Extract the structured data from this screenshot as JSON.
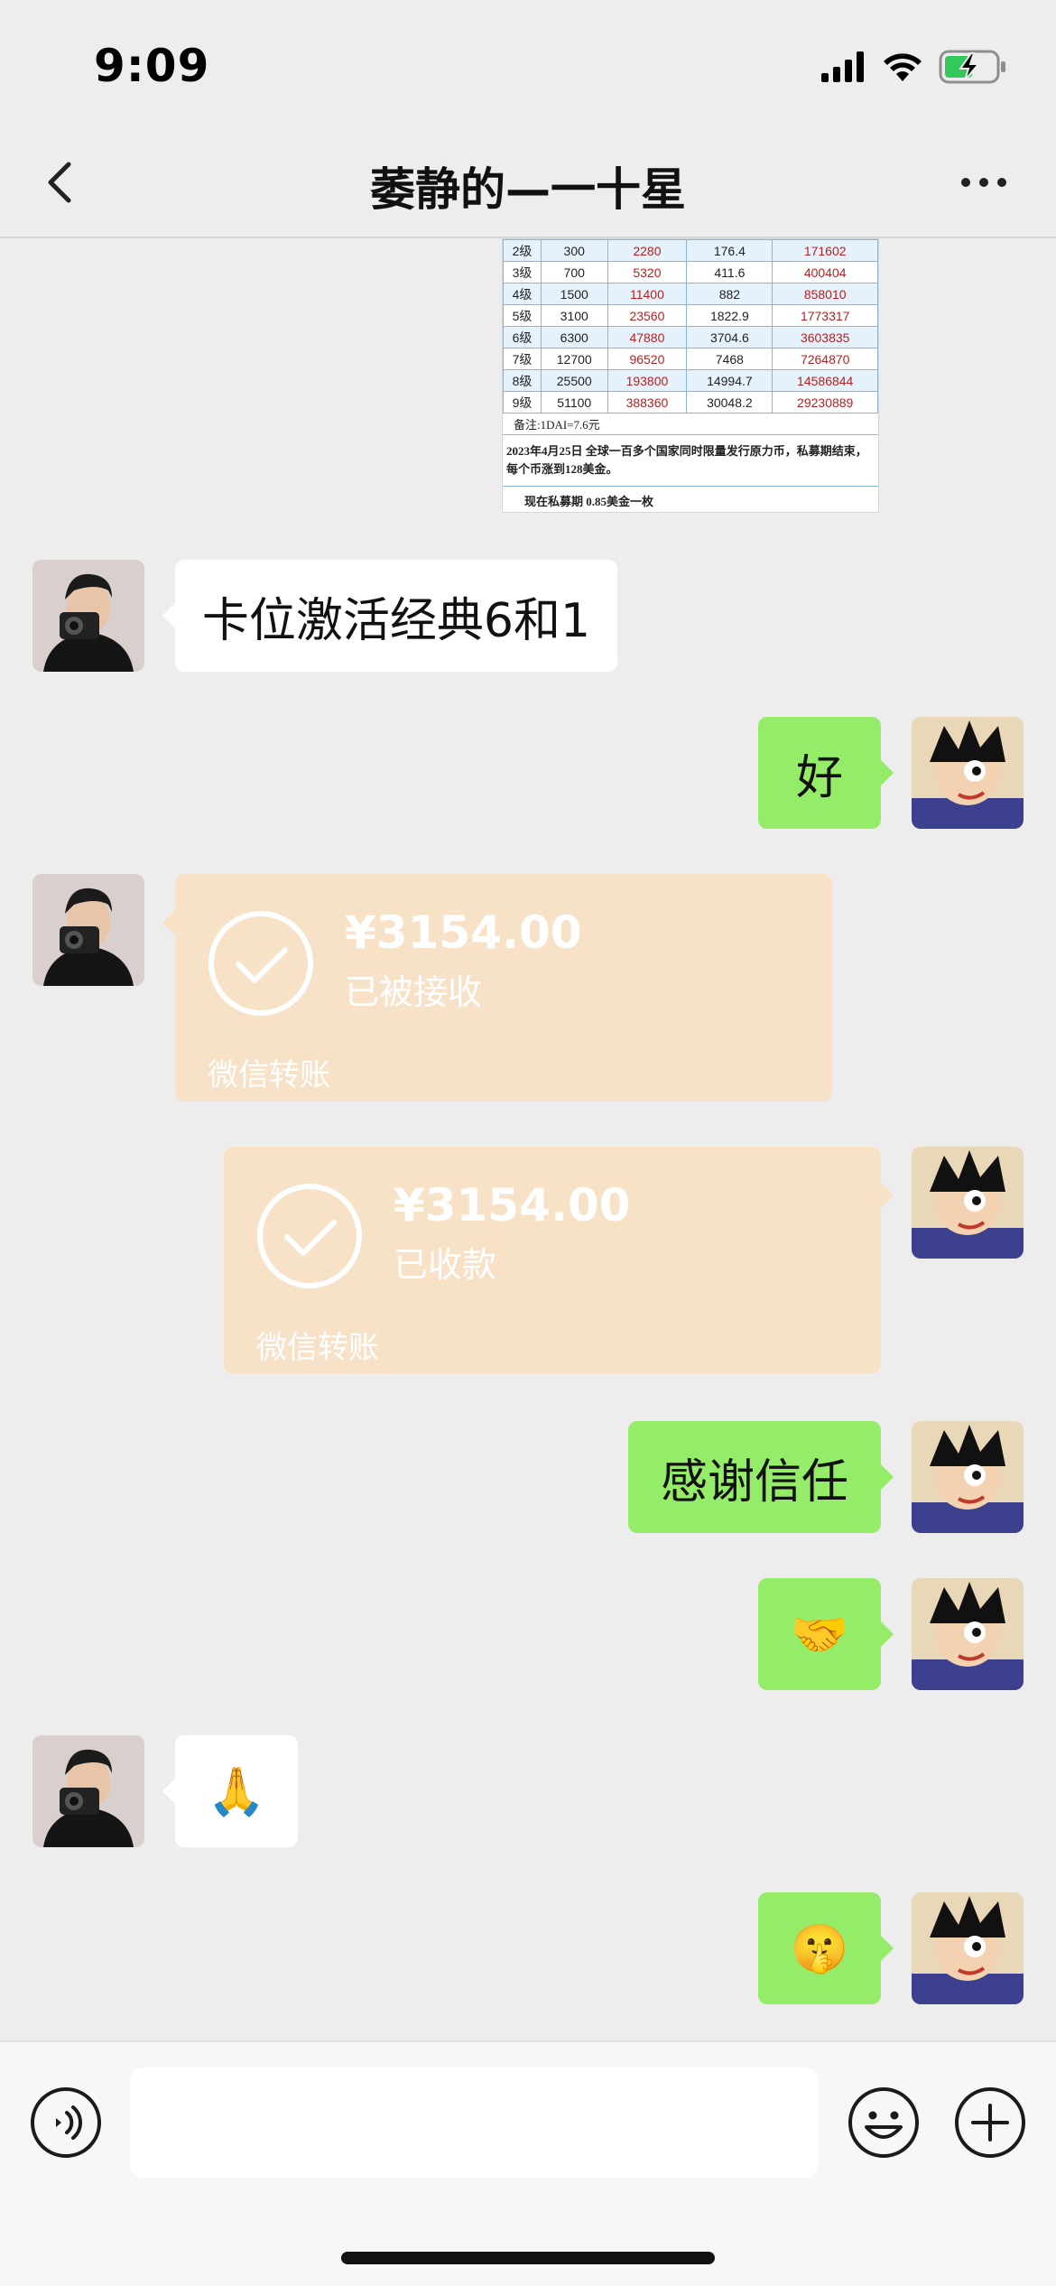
{
  "status_bar": {
    "time": "9:09"
  },
  "nav": {
    "title": "萎静的—一十星",
    "back_icon": "chevron-left-icon",
    "more_icon": "ellipsis-icon"
  },
  "table_image": {
    "rows": [
      [
        "2级",
        "300",
        "2280",
        "176.4",
        "171602"
      ],
      [
        "3级",
        "700",
        "5320",
        "411.6",
        "400404"
      ],
      [
        "4级",
        "1500",
        "11400",
        "882",
        "858010"
      ],
      [
        "5级",
        "3100",
        "23560",
        "1822.9",
        "1773317"
      ],
      [
        "6级",
        "6300",
        "47880",
        "3704.6",
        "3603835"
      ],
      [
        "7级",
        "12700",
        "96520",
        "7468",
        "7264870"
      ],
      [
        "8级",
        "25500",
        "193800",
        "14994.7",
        "14586844"
      ],
      [
        "9级",
        "51100",
        "388360",
        "30048.2",
        "29230889"
      ]
    ],
    "note": "备注:1DAI=7.6元",
    "paragraph": "2023年4月25日 全球一百多个国家同时限量发行原力币，私募期结束，每个币涨到128美金。",
    "footer": "现在私募期 0.85美金一枚"
  },
  "messages": {
    "m1": "卡位激活经典6和1",
    "m2": "好",
    "m3": {
      "amount": "¥3154.00",
      "status": "已被接收",
      "brand": "微信转账"
    },
    "m4": {
      "amount": "¥3154.00",
      "status": "已收款",
      "brand": "微信转账"
    },
    "m5": "感谢信任",
    "m6": "🤝",
    "m7": "🙏",
    "m8": "🤫"
  },
  "input": {
    "placeholder": ""
  },
  "colors": {
    "green_bubble": "#95ec69",
    "transfer_bg": "#f7e2c8",
    "chat_bg": "#ededed"
  }
}
